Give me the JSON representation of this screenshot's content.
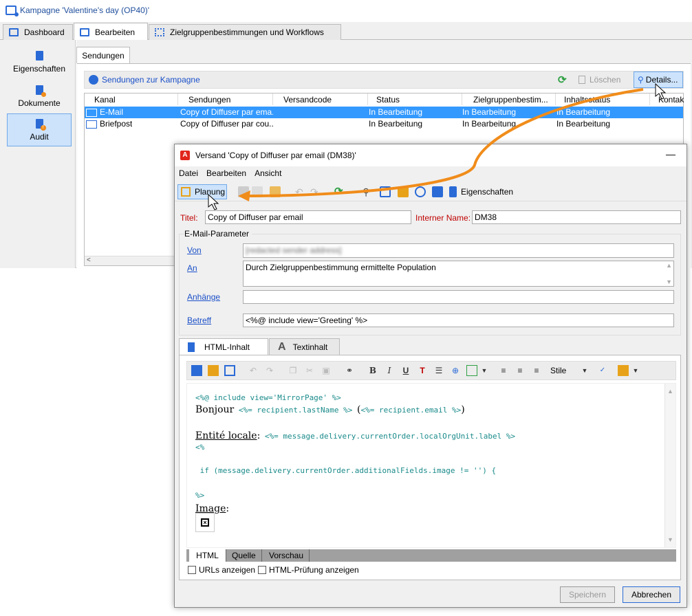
{
  "window": {
    "title": "Kampagne 'Valentine's day (OP40)'"
  },
  "tabs": [
    {
      "label": "Dashboard"
    },
    {
      "label": "Bearbeiten"
    },
    {
      "label": "Zielgruppenbestimmungen und Workflows"
    }
  ],
  "sidebar": {
    "items": [
      {
        "label": "Eigenschaften"
      },
      {
        "label": "Dokumente"
      },
      {
        "label": "Audit"
      }
    ]
  },
  "subtab": {
    "label": "Sendungen"
  },
  "toolbar": {
    "link_label": "Sendungen zur Kampagne",
    "delete_label": "Löschen",
    "details_label": "Details..."
  },
  "list": {
    "columns": [
      "Kanal",
      "Sendungen",
      "Versandcode",
      "Status",
      "Zielgruppenbestim...",
      "Inhaltsstatus",
      "Kontak"
    ],
    "rows": [
      {
        "kanal": "E-Mail",
        "sendungen": "Copy of Diffuser par ema...",
        "status": "In Bearbeitung",
        "ziel": "In Bearbeitung",
        "inhalt": "In Bearbeitung"
      },
      {
        "kanal": "Briefpost",
        "sendungen": "Copy of Diffuser par cou...",
        "status": "In Bearbeitung",
        "ziel": "In Bearbeitung",
        "inhalt": "In Bearbeitung"
      }
    ]
  },
  "dialog": {
    "title": "Versand 'Copy of Diffuser par email (DM38)'",
    "close": "—",
    "menu": [
      "Datei",
      "Bearbeiten",
      "Ansicht"
    ],
    "toolbar": {
      "planung": "Planung",
      "eigenschaften": "Eigenschaften"
    },
    "form": {
      "title_label": "Titel:",
      "title_value": "Copy of Diffuser par email",
      "internal_label": "Interner Name:",
      "internal_value": "DM38",
      "params_label": "E-Mail-Parameter",
      "from_label": "Von",
      "from_value": "[redacted sender address]",
      "to_label": "An",
      "to_value": "Durch Zielgruppenbestimmung ermittelte Population",
      "attach_label": "Anhänge",
      "subject_label": "Betreff",
      "subject_value": "<%@ include view='Greeting' %>"
    },
    "editor_tabs": [
      {
        "label": "HTML-Inhalt"
      },
      {
        "label": "Textinhalt"
      }
    ],
    "editor_toolbar": {
      "style_label": "Stile"
    },
    "code": {
      "line1": "<%@ include view='MirrorPage' %>",
      "bonjour": "Bonjour",
      "line2a": "<%= recipient.lastName %>",
      "paren_open": "(",
      "line2b": "<%= recipient.email %>",
      "paren_close": ")",
      "entite": "Entité locale",
      "colon": ":",
      "line3": "<%= message.delivery.currentOrder.localOrgUnit.label %>",
      "line4": "<%",
      "line5": " if (message.delivery.currentOrder.additionalFields.image != '') {",
      "line6": "%>",
      "image": "Image",
      "colon2": ":"
    },
    "modes": [
      "HTML",
      "Quelle",
      "Vorschau"
    ],
    "checks": {
      "urls": "URLs anzeigen",
      "html": "HTML-Prüfung anzeigen"
    },
    "buttons": {
      "save": "Speichern",
      "cancel": "Abbrechen"
    }
  },
  "colors": {
    "accent": "#2a6ad6",
    "selection": "#3399ff",
    "arrow": "#f08c1a",
    "required": "#c00000"
  }
}
